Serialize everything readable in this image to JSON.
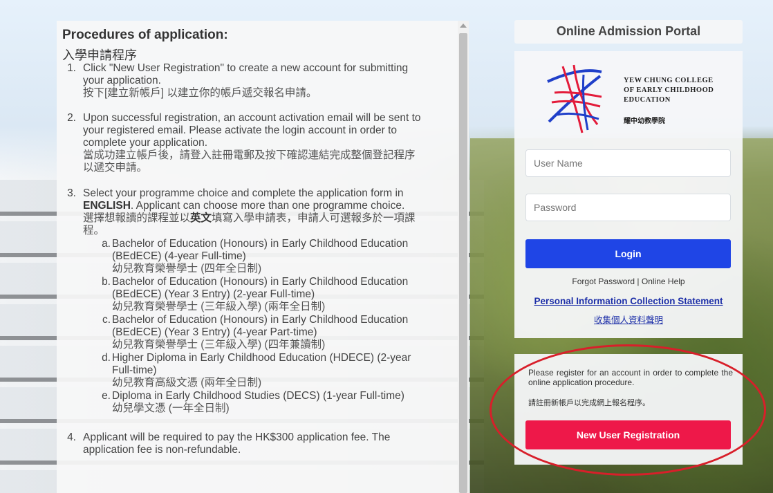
{
  "procedures": {
    "title": "Procedures of application:",
    "title_zh": "入學申請程序",
    "steps": [
      {
        "num": "1.",
        "en_lines": [
          "Click \"New User Registration\" to create a new account for submitting",
          "your application."
        ],
        "zh_lines": [
          "按下[建立新帳戶] 以建立你的帳戶遞交報名申請。"
        ]
      },
      {
        "num": "2.",
        "en_lines": [
          "Upon successful registration, an account activation email will be sent to",
          "your registered email. Please activate the login account in order to",
          "complete your application."
        ],
        "zh_lines": [
          "當成功建立帳戶後，請登入註冊電郵及按下確認連結完成整個登記程序",
          "以遞交申請。"
        ]
      },
      {
        "num": "3.",
        "en_line1_pre": "Select your programme choice and complete the application form in",
        "en_line2_bold": "ENGLISH",
        "en_line2_rest": ". Applicant can choose more than one programme choice.",
        "zh_line1_pre": "選擇想報讀的課程並以",
        "zh_line1_bold": "英文",
        "zh_line1_rest": "填寫入學申請表，申請人可選報多於一項課",
        "zh_line2": "程。",
        "programmes": [
          {
            "letter": "a.",
            "en_lines": [
              "Bachelor of Education (Honours) in Early Childhood Education",
              "(BEdECE) (4-year Full-time)"
            ],
            "zh": "幼兒教育榮譽學士 (四年全日制)"
          },
          {
            "letter": "b.",
            "en_lines": [
              "Bachelor of Education (Honours) in Early Childhood Education",
              "(BEdECE) (Year 3 Entry) (2-year Full-time)"
            ],
            "zh": "幼兒教育榮譽學士 (三年級入學) (兩年全日制)"
          },
          {
            "letter": "c.",
            "en_lines": [
              "Bachelor of Education (Honours) in Early Childhood Education",
              "(BEdECE) (Year 3 Entry) (4-year Part-time)"
            ],
            "zh": "幼兒教育榮譽學士 (三年級入學) (四年兼讀制)"
          },
          {
            "letter": "d.",
            "en_lines": [
              "Higher Diploma in Early Childhood Education (HDECE) (2-year",
              "Full-time)"
            ],
            "zh": "幼兒教育高級文憑 (兩年全日制)"
          },
          {
            "letter": "e.",
            "en_lines": [
              "Diploma in Early Childhood Studies (DECS) (1-year Full-time)"
            ],
            "zh": "幼兒學文憑 (一年全日制)"
          }
        ]
      },
      {
        "num": "4.",
        "en_lines": [
          "Applicant will be required to pay the HK$300 application fee. The",
          "application fee is non-refundable."
        ]
      }
    ]
  },
  "portal": {
    "title": "Online Admission Portal",
    "logo": {
      "line1": "YEW CHUNG COLLEGE",
      "line2": "OF EARLY CHILDHOOD",
      "line3": "EDUCATION",
      "zh": "耀中幼教學院",
      "colors": {
        "red": "#e31b3a",
        "blue": "#1f3fc9"
      }
    },
    "username_placeholder": "User Name",
    "password_placeholder": "Password",
    "login_label": "Login",
    "forgot_password": "Forgot Password",
    "separator": " | ",
    "online_help": "Online Help",
    "pics_label": "Personal Information Collection Statement",
    "pics_zh": "收集個人資料聲明"
  },
  "registration": {
    "text": "Please register for an account in order to complete the online application procedure.",
    "text_zh": "請註冊新帳戶以完成網上報名程序。",
    "button_label": "New User Registration"
  },
  "colors": {
    "login_button": "#1f45e6",
    "register_button": "#ee1849",
    "link": "#1d2fa8",
    "highlight_ellipse": "#d81f2a"
  }
}
